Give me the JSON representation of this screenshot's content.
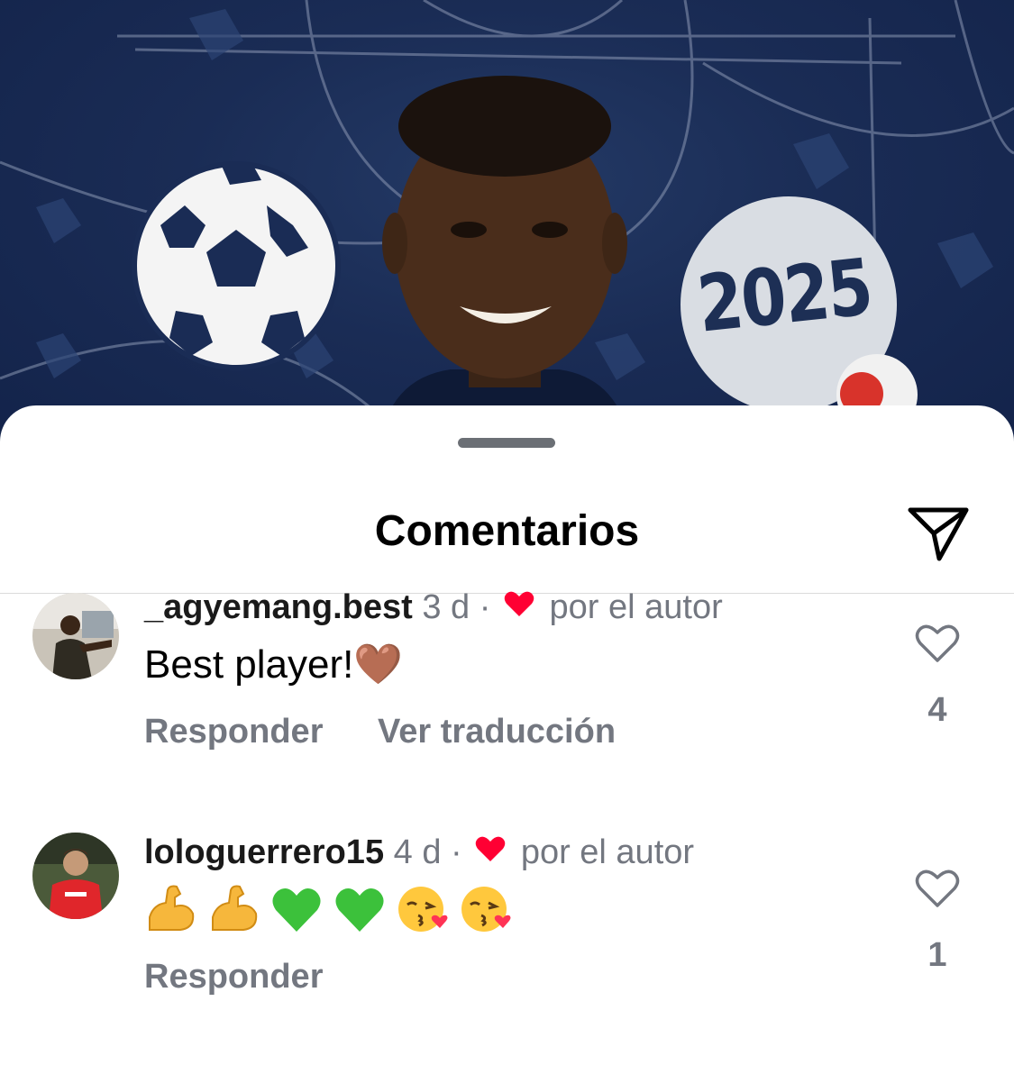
{
  "post_image": {
    "year_text": "2025"
  },
  "sheet": {
    "title": "Comentarios",
    "share_icon": "paper-plane-icon"
  },
  "comments": [
    {
      "username": "_agyemang.best",
      "time": "3 d",
      "separator": "·",
      "liked_by_author_text": "por el autor",
      "text": "Best player!🤎",
      "actions": [
        "Responder",
        "Ver traducción"
      ],
      "likes": "4",
      "avatar_icon": "user-avatar"
    },
    {
      "username": "lologuerrero15",
      "time": "4 d",
      "separator": "·",
      "liked_by_author_text": "por el autor",
      "emojis": [
        "💪",
        "💪",
        "💚",
        "💚",
        "😘",
        "😘"
      ],
      "actions": [
        "Responder"
      ],
      "likes": "1",
      "avatar_icon": "user-avatar"
    }
  ],
  "colors": {
    "author_heart": "#ff0033",
    "muted_text": "#737780",
    "post_background": "#1a2c55"
  }
}
